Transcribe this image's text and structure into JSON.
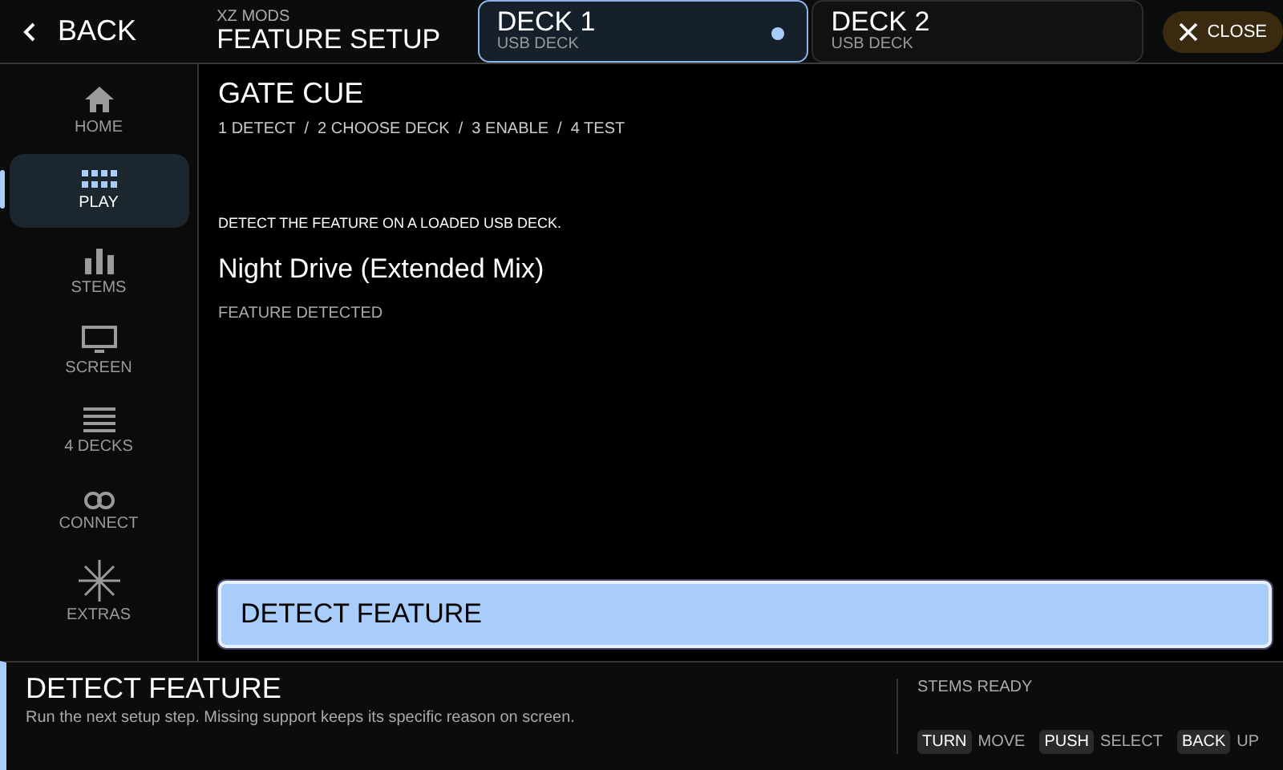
{
  "header": {
    "back": "BACK",
    "app": "XZ MODS",
    "title": "FEATURE SETUP",
    "close": "CLOSE"
  },
  "decks": [
    {
      "label": "DECK 1",
      "sub": "USB DECK",
      "selected": true
    },
    {
      "label": "DECK 2",
      "sub": "USB DECK",
      "selected": false
    }
  ],
  "sidebar": {
    "items": [
      {
        "label": "HOME",
        "selected": false
      },
      {
        "label": "PLAY",
        "selected": true
      },
      {
        "label": "STEMS",
        "selected": false
      },
      {
        "label": "SCREEN",
        "selected": false
      },
      {
        "label": "4 DECKS",
        "selected": false
      },
      {
        "label": "CONNECT",
        "selected": false
      },
      {
        "label": "EXTRAS",
        "selected": false
      }
    ]
  },
  "main": {
    "title": "GATE CUE",
    "steps": "1 DETECT  /  2 CHOOSE DECK  /  3 ENABLE  /  4 TEST",
    "instruction": "DETECT THE FEATURE ON A LOADED USB DECK.",
    "track": "Night Drive (Extended Mix)",
    "status": "FEATURE DETECTED",
    "action": "DETECT FEATURE"
  },
  "footer": {
    "title": "DETECT FEATURE",
    "text": "Run the next setup step. Missing support keeps its specific reason on screen.",
    "state": "STEMS READY",
    "hints": [
      {
        "key": "TURN",
        "action": "MOVE"
      },
      {
        "key": "PUSH",
        "action": "SELECT"
      },
      {
        "key": "BACK",
        "action": "UP"
      }
    ]
  }
}
